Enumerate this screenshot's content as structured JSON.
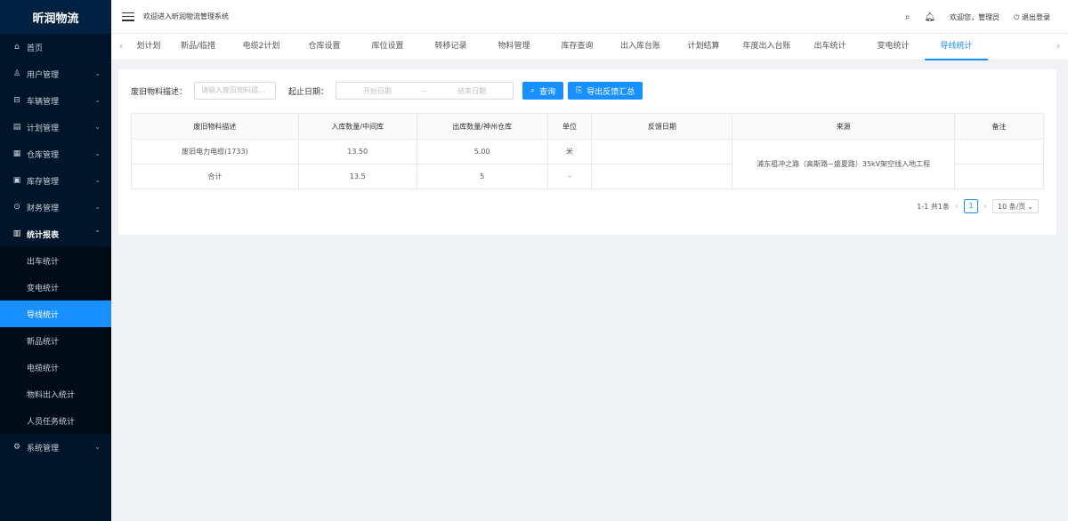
{
  "app": {
    "logo": "昕润物流"
  },
  "header": {
    "welcome": "欢迎进入昕润物流管理系统",
    "greeting": "欢迎您，管理员",
    "logout": "退出登录",
    "icons": [
      "menu-fold-icon",
      "search-icon",
      "bell-icon",
      "logout-icon"
    ]
  },
  "sidebar": {
    "items": [
      {
        "label": "首页",
        "icon": "home-icon"
      },
      {
        "label": "用户管理",
        "icon": "user-icon"
      },
      {
        "label": "车辆管理",
        "icon": "car-icon"
      },
      {
        "label": "计划管理",
        "icon": "file-icon"
      },
      {
        "label": "仓库管理",
        "icon": "warehouse-icon"
      },
      {
        "label": "库存管理",
        "icon": "inventory-icon"
      },
      {
        "label": "财务管理",
        "icon": "finance-icon"
      },
      {
        "label": "统计报表",
        "icon": "chart-icon"
      },
      {
        "label": "系统管理",
        "icon": "settings-icon"
      }
    ],
    "subitems": [
      "出车统计",
      "变电统计",
      "导线统计",
      "新品统计",
      "电缆统计",
      "物料出入统计",
      "人员任务统计"
    ],
    "active_sub": "导线统计"
  },
  "tabs": [
    "划计划",
    "新品/临措",
    "电缆2计划",
    "仓库设置",
    "库位设置",
    "转移记录",
    "物料管理",
    "库存查询",
    "出入库台账",
    "计划结算",
    "年度出入台账",
    "出车统计",
    "变电统计",
    "导线统计"
  ],
  "active_tab": "导线统计",
  "filter": {
    "desc_label": "废旧物料描述：",
    "desc_placeholder": "请输入废旧物料描...",
    "date_label": "起止日期：",
    "start_placeholder": "开始日期",
    "separator": "~",
    "end_placeholder": "结束日期",
    "search_btn": "查询",
    "export_btn": "导出反馈汇总"
  },
  "table": {
    "headers": [
      "废旧物料描述",
      "入库数量/中间库",
      "出库数量/神州仓库",
      "单位",
      "反馈日期",
      "来源",
      "备注"
    ],
    "rows": [
      {
        "desc": "废旧电力电缆(1733)",
        "in_qty": "13.50",
        "out_qty": "5.00",
        "unit": "米",
        "date": "",
        "remark": ""
      },
      {
        "desc": "合计",
        "in_qty": "13.5",
        "out_qty": "5",
        "unit": "-",
        "date": "",
        "remark": ""
      }
    ],
    "source": "浦东祖冲之路（高斯路~盛夏路）35kV架空线入地工程"
  },
  "pagination": {
    "summary": "1-1 共1条",
    "page": "1",
    "page_size": "10 条/页"
  }
}
